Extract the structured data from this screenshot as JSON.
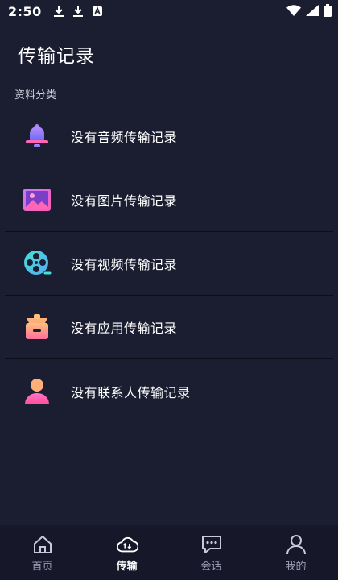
{
  "status_bar": {
    "time": "2:50"
  },
  "header": {
    "title": "传输记录"
  },
  "section": {
    "label": "资料分类"
  },
  "categories": [
    {
      "icon": "bell-icon",
      "label": "没有音频传输记录"
    },
    {
      "icon": "picture-icon",
      "label": "没有图片传输记录"
    },
    {
      "icon": "film-reel-icon",
      "label": "没有视频传输记录"
    },
    {
      "icon": "app-box-icon",
      "label": "没有应用传输记录"
    },
    {
      "icon": "person-icon",
      "label": "没有联系人传输记录"
    }
  ],
  "tabs": [
    {
      "icon": "home-icon",
      "label": "首页",
      "active": false
    },
    {
      "icon": "cloud-transfer-icon",
      "label": "传输",
      "active": true
    },
    {
      "icon": "chat-icon",
      "label": "会话",
      "active": false
    },
    {
      "icon": "user-icon",
      "label": "我的",
      "active": false
    }
  ],
  "colors": {
    "background": "#1b1d31",
    "tabbar": "#161728",
    "divider": "#0c0d18",
    "accent_pink": "#f04fa3",
    "accent_purple": "#9a5cf0",
    "accent_teal": "#35d7d0"
  }
}
